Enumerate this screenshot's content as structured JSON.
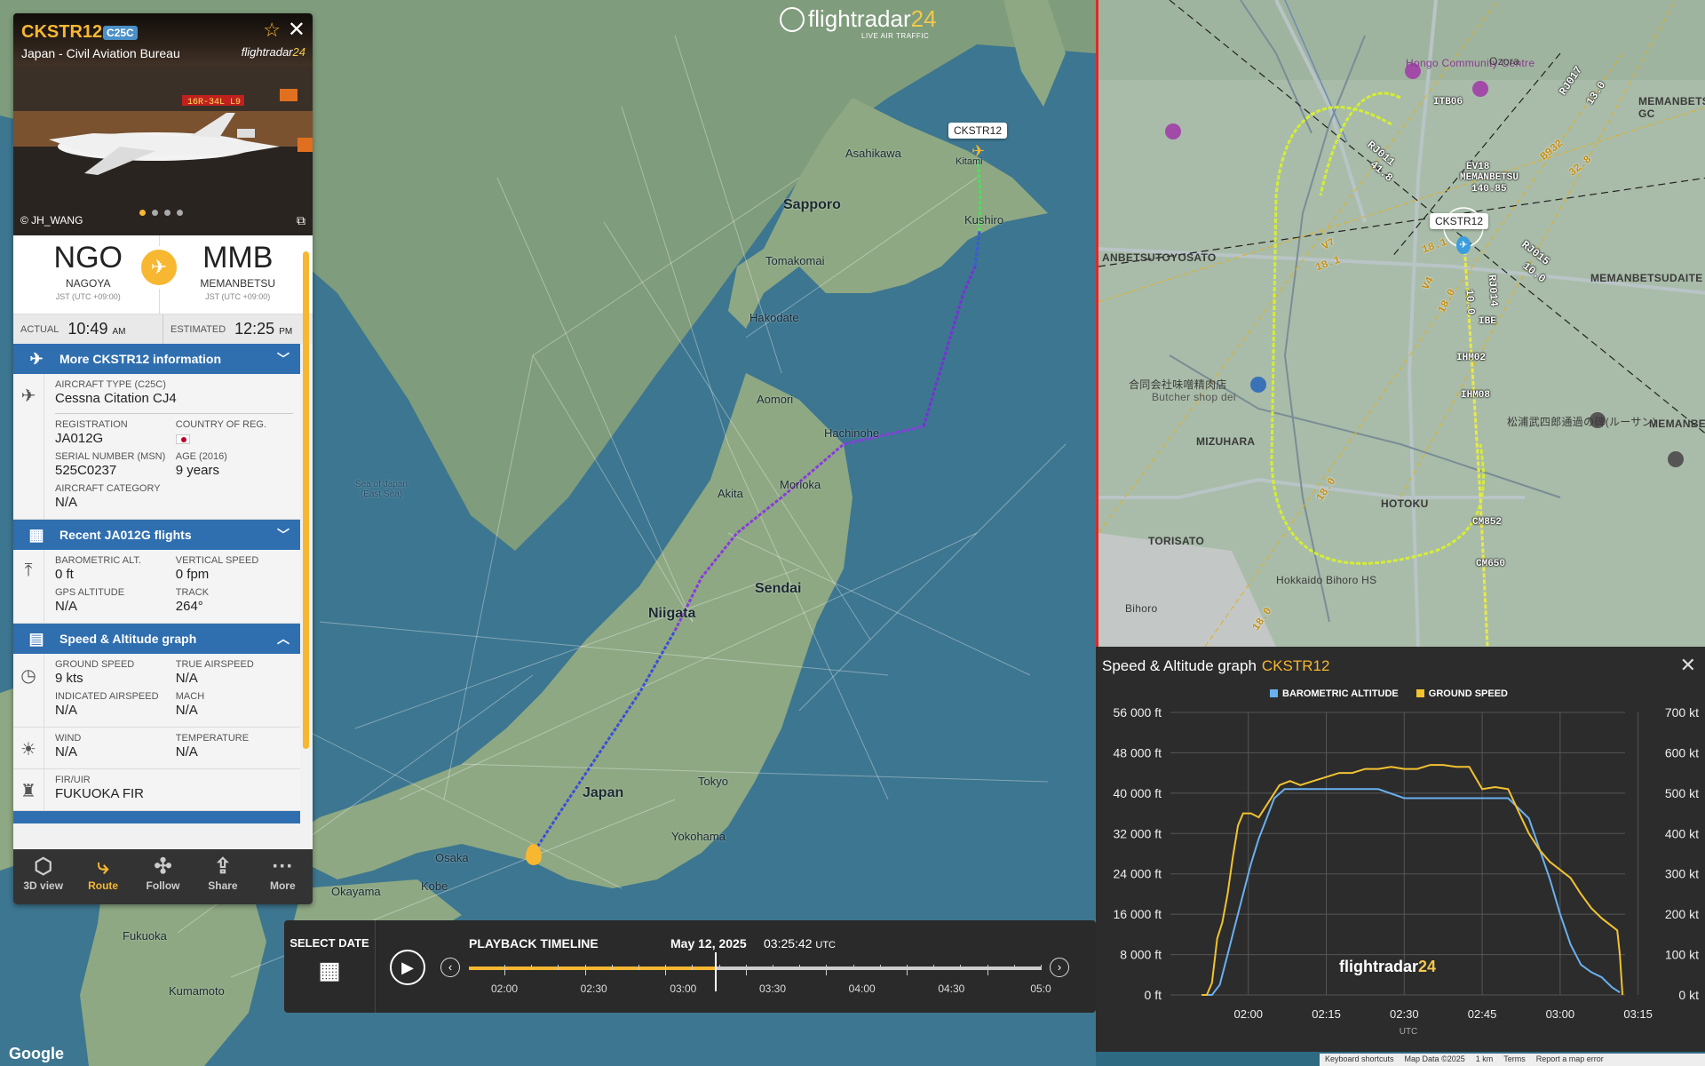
{
  "brand": {
    "name_main": "flightradar",
    "name_num": "24",
    "tagline": "LIVE AIR TRAFFIC"
  },
  "flight": {
    "callsign": "CKSTR12",
    "type_badge": "C25C",
    "operator": "Japan - Civil Aviation Bureau",
    "photo_credit": "© JH_WANG",
    "origin": {
      "code": "NGO",
      "city": "NAGOYA",
      "tz": "JST (UTC +09:00)"
    },
    "destination": {
      "code": "MMB",
      "city": "MEMANBETSU",
      "tz": "JST (UTC +09:00)"
    },
    "actual_label": "ACTUAL",
    "actual_time": "10:49",
    "actual_ampm": "AM",
    "estimated_label": "ESTIMATED",
    "estimated_time": "12:25",
    "estimated_ampm": "PM"
  },
  "sections": {
    "more_info": "More CKSTR12 information",
    "recent": "Recent JA012G flights",
    "graph": "Speed & Altitude graph"
  },
  "aircraft": {
    "type_label": "AIRCRAFT TYPE (C25C)",
    "type_value": "Cessna Citation CJ4",
    "reg_label": "REGISTRATION",
    "reg_value": "JA012G",
    "country_label": "COUNTRY OF REG.",
    "msn_label": "SERIAL NUMBER (MSN)",
    "msn_value": "525C0237",
    "age_label": "AGE (2016)",
    "age_value": "9 years",
    "cat_label": "AIRCRAFT CATEGORY",
    "cat_value": "N/A"
  },
  "altitude": {
    "baro_label": "BAROMETRIC ALT.",
    "baro_value": "0 ft",
    "vs_label": "VERTICAL SPEED",
    "vs_value": "0 fpm",
    "gps_label": "GPS ALTITUDE",
    "gps_value": "N/A",
    "track_label": "TRACK",
    "track_value": "264°"
  },
  "speed": {
    "gs_label": "GROUND SPEED",
    "gs_value": "9 kts",
    "tas_label": "TRUE AIRSPEED",
    "tas_value": "N/A",
    "ias_label": "INDICATED AIRSPEED",
    "ias_value": "N/A",
    "mach_label": "MACH",
    "mach_value": "N/A"
  },
  "weather": {
    "wind_label": "WIND",
    "wind_value": "N/A",
    "temp_label": "TEMPERATURE",
    "temp_value": "N/A"
  },
  "fir": {
    "label": "FIR/UIR",
    "value": "FUKUOKA FIR"
  },
  "toolbar": [
    {
      "label": "3D view",
      "icon": "cube-icon"
    },
    {
      "label": "Route",
      "icon": "route-icon"
    },
    {
      "label": "Follow",
      "icon": "follow-icon"
    },
    {
      "label": "Share",
      "icon": "share-icon"
    },
    {
      "label": "More",
      "icon": "more-icon"
    }
  ],
  "playback": {
    "select_date": "SELECT DATE",
    "title": "PLAYBACK TIMELINE",
    "date": "May 12, 2025",
    "time": "03:25:42",
    "tz": "UTC",
    "progress": 0.43,
    "ticks": [
      "02:00",
      "02:30",
      "03:00",
      "03:30",
      "04:00",
      "04:30",
      "05:0"
    ]
  },
  "main_map": {
    "labels": [
      "Sapporo",
      "Sendai",
      "Niigata",
      "Japan",
      "Tokyo",
      "Yokohama",
      "Osaka",
      "Kobe",
      "Okayama",
      "Fukuoka",
      "Kumamoto",
      "Aomori",
      "Hachinohe",
      "Morioka",
      "Akita",
      "Tomakomai",
      "Asahikawa",
      "Kushiro",
      "Hakodate",
      "Sea of Japan\n(East Sea)",
      "Kitami"
    ],
    "callsign_tag": "CKSTR12",
    "google": "Google"
  },
  "detail_map": {
    "callsign_tag": "CKSTR12",
    "labels": [
      "ANBETSUTOYOSATO",
      "MIZUHARA",
      "HOTOKU",
      "TORISATO",
      "MEMANBETSU GC",
      "MEMANBETSUDAITE",
      "MEMANBETSU",
      "Hokkaido Bihoro HS",
      "Bihoro",
      "Hongo Community Centre",
      "Ozora",
      "合同会社味噌精肉店",
      "Butcher shop dei",
      "松浦武四郎通過の碑(ルーサン)"
    ],
    "waypoints": [
      "ITB06",
      "EV18",
      "MEMANBETSU",
      "140.85",
      "IBE",
      "IHM02",
      "IHM08",
      "CM852",
      "CM650"
    ],
    "airways": [
      "RJ017",
      "13.0",
      "B932",
      "32.8",
      "RJ011",
      "41.8",
      "RJ015",
      "10.0",
      "RJ014",
      "10.0",
      "V7",
      "18.1",
      "V4",
      "18.0",
      "18.1",
      "18.0",
      "18.0"
    ]
  },
  "bottom_bar": [
    "Keyboard shortcuts",
    "Map Data ©2025",
    "1 km",
    "Terms",
    "Report a map error"
  ],
  "chart_data": {
    "type": "line",
    "title": "Speed & Altitude graph",
    "subtitle": "CKSTR12",
    "xlabel": "UTC",
    "x_ticks": [
      "02:00",
      "02:15",
      "02:30",
      "02:45",
      "03:00",
      "03:15"
    ],
    "y_left_ticks": [
      "0 ft",
      "8 000 ft",
      "16 000 ft",
      "24 000 ft",
      "32 000 ft",
      "40 000 ft",
      "48 000 ft",
      "56 000 ft"
    ],
    "y_right_ticks": [
      "0 kt",
      "100 kt",
      "200 kt",
      "300 kt",
      "400 kt",
      "500 kt",
      "600 kt",
      "700 kt"
    ],
    "y_left_lim": [
      0,
      56000
    ],
    "y_right_lim": [
      0,
      700
    ],
    "x_range_min": [
      104,
      265
    ],
    "legend": "top",
    "series": [
      {
        "name": "BAROMETRIC ALTITUDE",
        "color": "#6ab0f0",
        "axis": "left",
        "x": [
          104,
          106,
          109,
          112,
          115,
          118,
          121,
          124,
          127,
          130,
          134,
          140,
          150,
          160,
          170,
          180,
          190,
          200,
          210,
          220,
          228,
          232,
          236,
          240,
          244,
          248,
          252,
          256,
          258,
          260,
          263
        ],
        "y": [
          0,
          0,
          2000,
          8000,
          14000,
          20000,
          26000,
          31000,
          35000,
          39000,
          40800,
          40800,
          40800,
          40800,
          40800,
          39000,
          39000,
          39000,
          39000,
          39000,
          35000,
          29000,
          23000,
          16000,
          10000,
          6000,
          4500,
          3500,
          2500,
          1500,
          500
        ]
      },
      {
        "name": "GROUND SPEED",
        "color": "#f2c230",
        "axis": "right",
        "x": [
          102,
          104,
          106,
          108,
          110,
          112,
          114,
          116,
          118,
          121,
          124,
          128,
          132,
          136,
          140,
          145,
          150,
          155,
          160,
          165,
          170,
          175,
          180,
          185,
          190,
          195,
          200,
          205,
          210,
          215,
          220,
          225,
          228,
          232,
          236,
          240,
          244,
          248,
          252,
          256,
          260,
          262,
          263,
          264
        ],
        "y": [
          0,
          0,
          30,
          140,
          180,
          250,
          340,
          420,
          450,
          450,
          440,
          480,
          520,
          530,
          520,
          530,
          540,
          550,
          550,
          560,
          560,
          565,
          560,
          560,
          570,
          570,
          565,
          565,
          510,
          515,
          510,
          440,
          400,
          360,
          330,
          310,
          290,
          250,
          215,
          190,
          170,
          160,
          100,
          0
        ]
      }
    ]
  }
}
